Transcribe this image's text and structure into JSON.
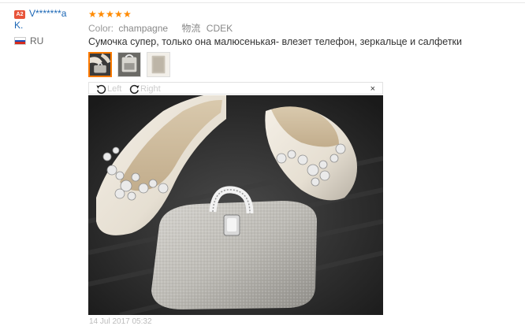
{
  "user": {
    "level_badge": "A2",
    "name_line1": "V*******a",
    "name_line2": "K.",
    "country": "RU"
  },
  "feedback": {
    "rating": 5,
    "star_glyph": "★",
    "color_label": "Color:",
    "color_value": "champagne",
    "shipping_label": "物流",
    "shipping_value": "CDEK",
    "text": "Сумочка супер, только она малюсенькая- влезет телефон, зеркальце и салфетки",
    "date": "14 Jul 2017 05:32"
  },
  "viewer": {
    "rotate_left_label": "Left",
    "rotate_right_label": "Right",
    "close_glyph": "×"
  },
  "colors": {
    "accent": "#ff7a00",
    "link": "#1a66b5",
    "badge": "#e8543a"
  }
}
